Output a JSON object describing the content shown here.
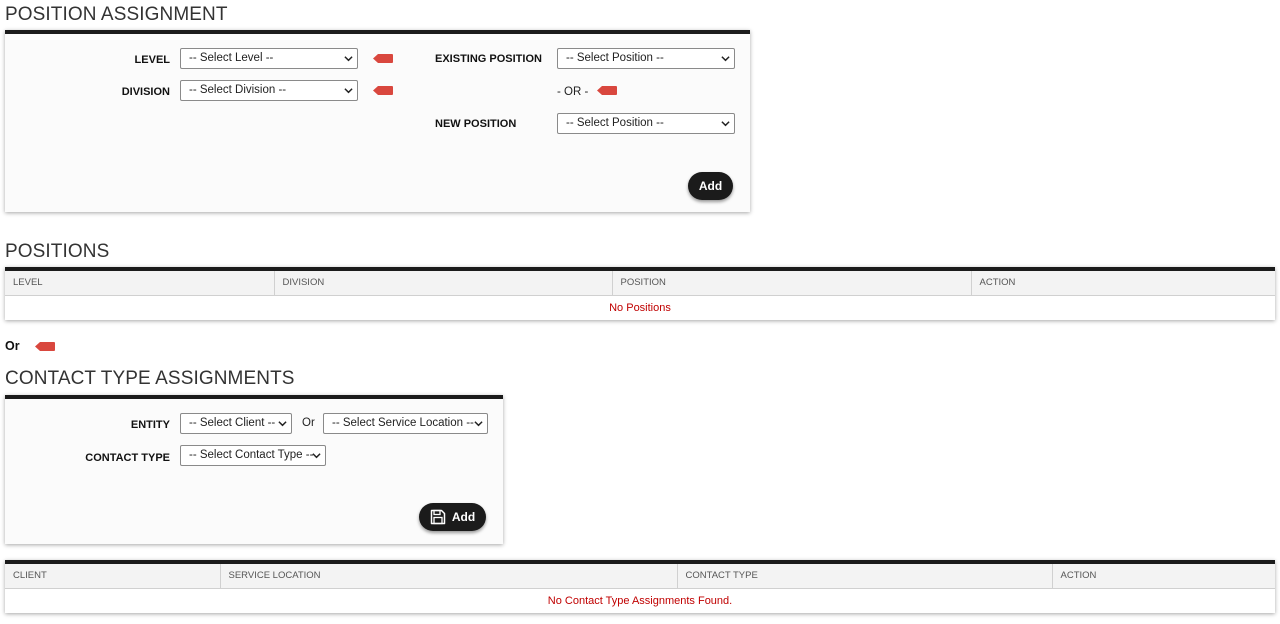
{
  "position_assignment": {
    "title": "POSITION ASSIGNMENT",
    "level_label": "LEVEL",
    "level_select": "-- Select Level --",
    "division_label": "DIVISION",
    "division_select": "-- Select Division --",
    "existing_position_label": "EXISTING POSITION",
    "existing_position_select": "-- Select Position --",
    "or_text": "- OR -",
    "new_position_label": "NEW POSITION",
    "new_position_select": "-- Select Position --",
    "add_label": "Add"
  },
  "positions": {
    "title": "POSITIONS",
    "columns": [
      "LEVEL",
      "DIVISION",
      "POSITION",
      "ACTION"
    ],
    "empty_text": "No Positions"
  },
  "or_separator": "Or",
  "contact_type_assignments": {
    "title": "CONTACT TYPE ASSIGNMENTS",
    "entity_label": "ENTITY",
    "client_select": "-- Select Client --",
    "or_text": "Or",
    "service_location_select": "-- Select Service Location --",
    "contact_type_label": "CONTACT TYPE",
    "contact_type_select": "-- Select Contact Type --",
    "add_label": "Add"
  },
  "contact_type_table": {
    "columns": [
      "CLIENT",
      "SERVICE LOCATION",
      "CONTACT TYPE",
      "ACTION"
    ],
    "empty_text": "No Contact Type Assignments Found."
  },
  "colors": {
    "accent": "#1b1b1b",
    "pin": "#d9473e",
    "empty_text": "#c00000"
  },
  "icons": {
    "pin": "tag-pin-icon",
    "chevron": "chevron-down-icon",
    "save": "floppy-disk-icon"
  }
}
